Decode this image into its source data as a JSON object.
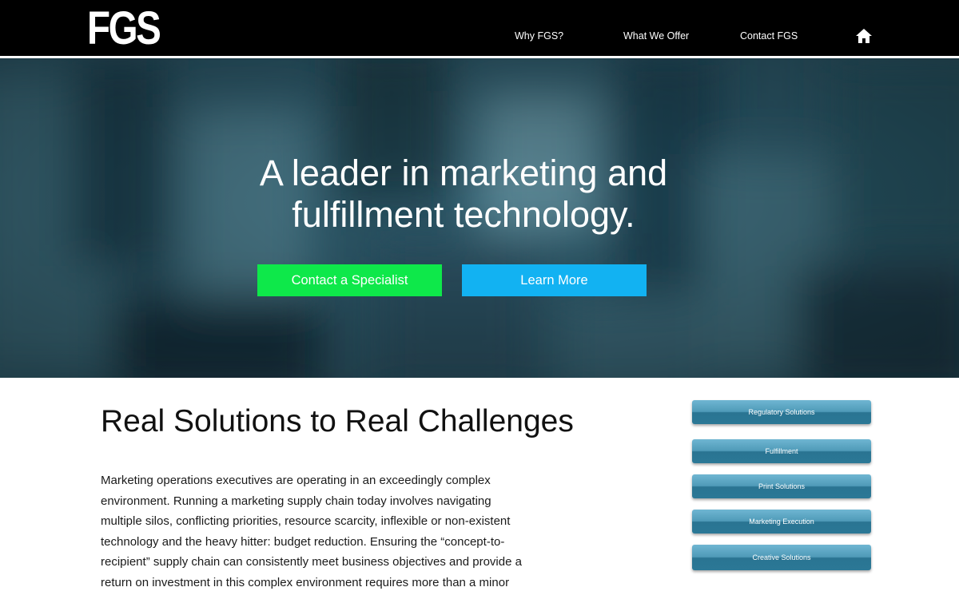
{
  "header": {
    "logo_text": "FGS",
    "nav": [
      {
        "label": "Why FGS?"
      },
      {
        "label": "What We Offer"
      },
      {
        "label": "Contact FGS"
      }
    ],
    "home_icon": "home-icon"
  },
  "hero": {
    "title_line1": "A leader in marketing and",
    "title_line2": "fulfillment technology.",
    "primary_button": "Contact a Specialist",
    "secondary_button": "Learn More",
    "colors": {
      "primary_button": "#0ee84a",
      "secondary_button": "#12b2f2",
      "background": "#2a5566"
    }
  },
  "main": {
    "heading": "Real Solutions to Real Challenges",
    "body": "Marketing operations executives are operating in an exceedingly complex environment. Running a marketing supply chain today involves navigating multiple silos, conflicting priorities, resource scarcity, inflexible or non-existent technology and the heavy hitter: budget reduction. Ensuring the “concept-to-recipient” supply chain can consistently meet business objectives and provide a return on investment in this complex environment requires more than a minor"
  },
  "sidebar": {
    "items": [
      {
        "label": "Regulatory Solutions"
      },
      {
        "label": "Fulfillment"
      },
      {
        "label": "Print Solutions"
      },
      {
        "label": "Marketing Execution"
      },
      {
        "label": "Creative Solutions"
      }
    ]
  }
}
